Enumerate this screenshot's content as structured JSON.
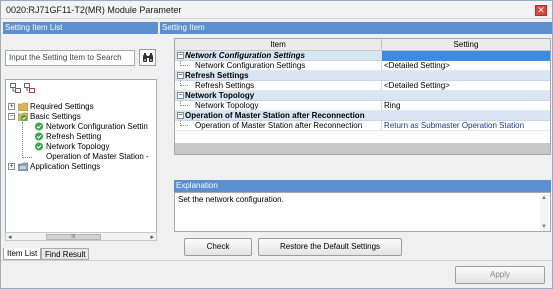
{
  "window": {
    "title": "0020:RJ71GF11-T2(MR) Module Parameter",
    "close_symbol": "✕"
  },
  "left_panel": {
    "header": "Setting Item List",
    "search_placeholder": "Input the Setting Item to Search",
    "search_icon": "binoculars-icon",
    "tree": [
      {
        "label": "Required Settings",
        "icon": "folder-icon"
      },
      {
        "label": "Basic Settings",
        "icon": "folder-check-icon"
      },
      {
        "label": "Network Configuration Settin",
        "icon": "check-icon"
      },
      {
        "label": "Refresh Setting",
        "icon": "check-icon"
      },
      {
        "label": "Network Topology",
        "icon": "check-icon"
      },
      {
        "label": "Operation of Master Station -",
        "icon": "none"
      },
      {
        "label": "Application Settings",
        "icon": "folder-icon"
      }
    ],
    "scroll_thumb": "III",
    "tabs": [
      "Item List",
      "Find Result"
    ]
  },
  "right_panel": {
    "header": "Setting Item",
    "columns": [
      "Item",
      "Setting"
    ],
    "rows": [
      {
        "type": "category",
        "label": "Network Configuration Settings",
        "italic": true
      },
      {
        "type": "item",
        "label": "Network Configuration Settings",
        "value": "<Detailed Setting>"
      },
      {
        "type": "category",
        "label": "Refresh Settings",
        "italic": false
      },
      {
        "type": "item",
        "label": "Refresh Settings",
        "value": "<Detailed Setting>"
      },
      {
        "type": "category",
        "label": "Network Topology",
        "italic": false
      },
      {
        "type": "item",
        "label": "Network Topology",
        "value": "Ring"
      },
      {
        "type": "category",
        "label": "Operation of Master Station after Reconnection",
        "italic": false
      },
      {
        "type": "item",
        "label": "Operation of Master Station after Reconnection",
        "value": "Return as Submaster Operation Station"
      }
    ],
    "explanation_header": "Explanation",
    "explanation_text": "Set the network configuration.",
    "check_button": "Check",
    "restore_button": "Restore the Default Settings",
    "apply_button": "Apply"
  },
  "colors": {
    "header_blue": "#5b8fd0",
    "category_bg": "#d9e5f2",
    "selected_setting": "#3d8be0"
  }
}
